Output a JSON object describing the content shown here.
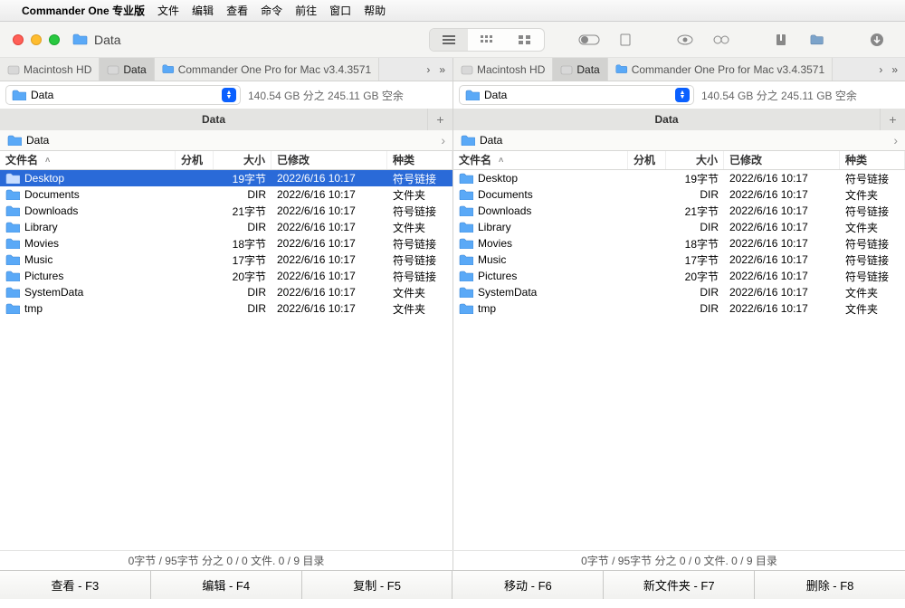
{
  "menubar": {
    "app": "Commander One 专业版",
    "items": [
      "文件",
      "编辑",
      "查看",
      "命令",
      "前往",
      "窗口",
      "帮助"
    ]
  },
  "window": {
    "title": "Data"
  },
  "tabs": {
    "left": [
      "Macintosh HD",
      "Data",
      "Commander One Pro for Mac v3.4.3571"
    ],
    "right": [
      "Macintosh HD",
      "Data",
      "Commander One Pro for Mac v3.4.3571"
    ],
    "active": 1
  },
  "location": {
    "left": {
      "label": "Data",
      "disk": "140.54 GB 分之 245.11 GB 空余"
    },
    "right": {
      "label": "Data",
      "disk": "140.54 GB 分之 245.11 GB 空余"
    }
  },
  "panelTab": {
    "left": "Data",
    "right": "Data"
  },
  "breadcrumb": {
    "left": "Data",
    "right": "Data"
  },
  "columns": {
    "name": "文件名",
    "ext": "分机",
    "size": "大小",
    "mod": "已修改",
    "kind": "种类"
  },
  "files": [
    {
      "name": "Desktop",
      "size": "19字节",
      "mod": "2022/6/16 10:17",
      "kind": "符号链接"
    },
    {
      "name": "Documents",
      "size": "DIR",
      "mod": "2022/6/16 10:17",
      "kind": "文件夹"
    },
    {
      "name": "Downloads",
      "size": "21字节",
      "mod": "2022/6/16 10:17",
      "kind": "符号链接"
    },
    {
      "name": "Library",
      "size": "DIR",
      "mod": "2022/6/16 10:17",
      "kind": "文件夹"
    },
    {
      "name": "Movies",
      "size": "18字节",
      "mod": "2022/6/16 10:17",
      "kind": "符号链接"
    },
    {
      "name": "Music",
      "size": "17字节",
      "mod": "2022/6/16 10:17",
      "kind": "符号链接"
    },
    {
      "name": "Pictures",
      "size": "20字节",
      "mod": "2022/6/16 10:17",
      "kind": "符号链接"
    },
    {
      "name": "SystemData",
      "size": "DIR",
      "mod": "2022/6/16 10:17",
      "kind": "文件夹"
    },
    {
      "name": "tmp",
      "size": "DIR",
      "mod": "2022/6/16 10:17",
      "kind": "文件夹"
    }
  ],
  "selectedIndexLeft": 0,
  "status": "0字节 / 95字节 分之 0 / 0 文件. 0 / 9 目录",
  "bottom": [
    "查看 - F3",
    "编辑 - F4",
    "复制 - F5",
    "移动 - F6",
    "新文件夹 - F7",
    "删除 - F8"
  ]
}
